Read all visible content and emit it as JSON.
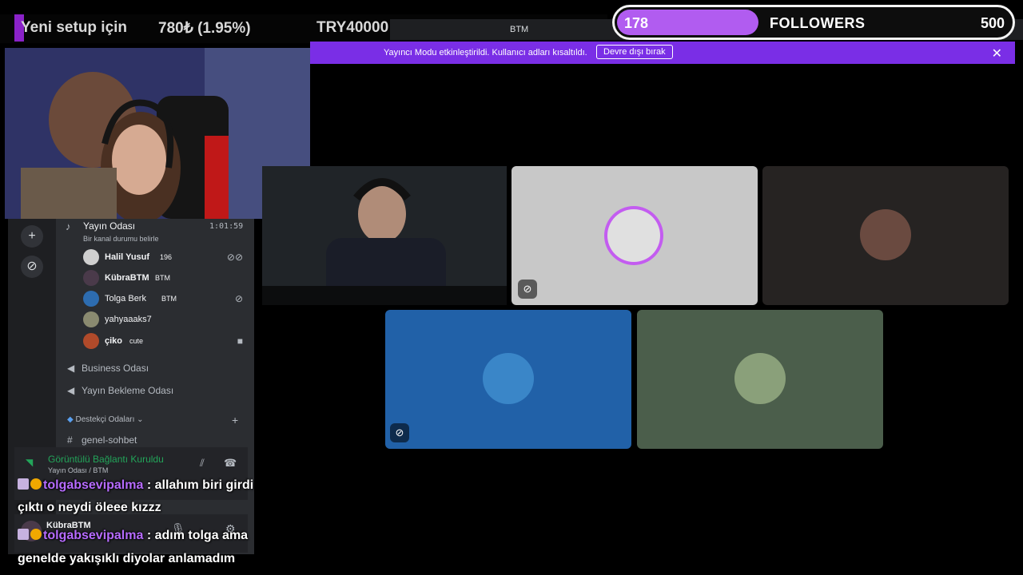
{
  "ticker": {
    "text1": "Yeni setup için",
    "text2": "780₺ (1.95%)",
    "text3": "TRY40000"
  },
  "window": {
    "title": "BTM"
  },
  "followers": {
    "current": "178",
    "label": "FOLLOWERS",
    "goal": "500",
    "progress_fraction": 0.356
  },
  "notice": {
    "message": "Yayıncı Modu etkinleştirildi. Kullanıcı adları kısaltıldı.",
    "button": "Devre dışı bırak"
  },
  "voice_room": {
    "name": "Yayın Odası",
    "status": "Bir kanal durumu belirle",
    "elapsed": "1:01:59",
    "users": [
      {
        "name": "Halil Yusuf",
        "badge": "196",
        "color": "#cfcfcf"
      },
      {
        "name": "KübraBTM",
        "badge": "BTM",
        "color": "#4a3a4a"
      },
      {
        "name": "Tolga Berk",
        "badge": "BTM",
        "color": "#2d6cb0"
      },
      {
        "name": "yahyaaaks7",
        "badge": "",
        "color": "#8a8a70"
      },
      {
        "name": "çiko",
        "badge": "cute",
        "color": "#b04a2a"
      }
    ]
  },
  "channels": {
    "business": "Business Odası",
    "waiting": "Yayın Bekleme Odası",
    "category": "Destekçi Odaları",
    "text": "genel-sohbet"
  },
  "voice_panel": {
    "status": "Görüntülü Bağlantı Kuruldu",
    "location": "Yayın Odası / BTM"
  },
  "user_panel": {
    "name": "KübraBTM"
  },
  "chat": [
    {
      "user": "tolgabsevipalma",
      "line1": " : allahım biri girdi",
      "line2": "çıktı o neydi öleee kızzz"
    },
    {
      "user": "tolgabsevipalma",
      "line1": " : adım tolga ama",
      "line2": "genelde yakışıklı diyolar anlamadım"
    }
  ],
  "icons": {
    "mute": "🔇",
    "add": "+",
    "compass": "⊘",
    "camera": "■",
    "gear": "⚙",
    "help": "?",
    "close": "✕",
    "hangup": "☎"
  }
}
